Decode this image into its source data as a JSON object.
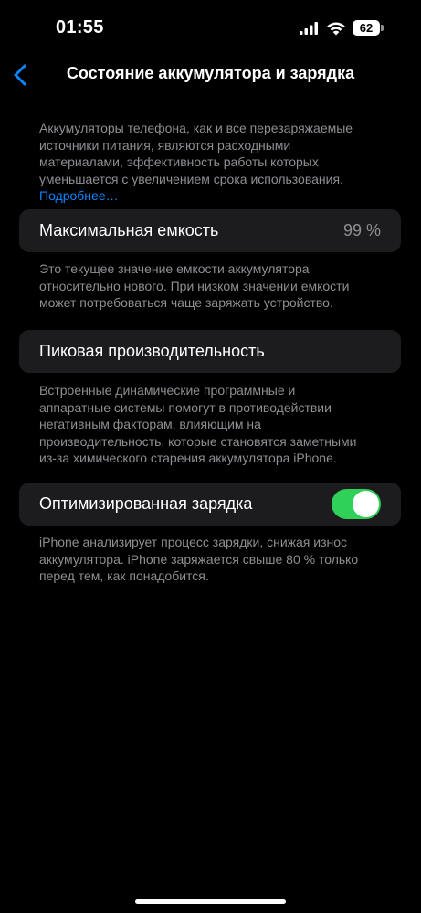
{
  "status_bar": {
    "time": "01:55",
    "battery_level": "62",
    "icons": [
      "signal-icon",
      "wifi-icon",
      "battery-icon"
    ]
  },
  "nav": {
    "back_icon": "chevron-left-icon",
    "title": "Состояние аккумулятора и зарядка"
  },
  "intro": {
    "text": "Аккумуляторы телефона, как и все перезаряжаемые источники питания, являются расходными материалами, эффективность работы которых уменьшается с увеличением срока использования. ",
    "link": "Подробнее…"
  },
  "max_capacity": {
    "label": "Максимальная емкость",
    "value": "99 %",
    "footnote": "Это текущее значение емкости аккумулятора относительно нового. При низком значении емкости может потребоваться чаще заряжать устройство."
  },
  "peak_performance": {
    "label": "Пиковая производительность",
    "footnote": "Встроенные динамические программные и аппаратные системы помогут в противодействии негативным факторам, влияющим на производительность, которые становятся заметными из-за химического старения аккумулятора iPhone."
  },
  "optimized_charging": {
    "label": "Оптимизированная зарядка",
    "enabled": true,
    "footnote": "iPhone анализирует процесс зарядки, снижая износ аккумулятора. iPhone заряжается свыше 80 % только перед тем, как понадобится."
  },
  "colors": {
    "background": "#000000",
    "cell": "#1c1c1e",
    "accent": "#0a84ff",
    "toggle_on": "#30d158",
    "secondary_text": "#8e8e93"
  }
}
